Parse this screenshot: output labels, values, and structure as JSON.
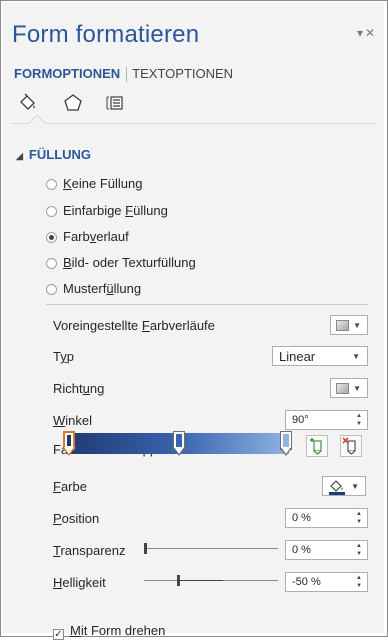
{
  "header": {
    "title": "Form formatieren",
    "dropdown_glyph": "▾",
    "close_glyph": "✕"
  },
  "tabs": {
    "active": "FORMOPTIONEN",
    "other": "TEXTOPTIONEN"
  },
  "icons": [
    "fill-line-icon",
    "effects-pentagon-icon",
    "size-properties-icon"
  ],
  "section": {
    "title": "FÜLLUNG",
    "toggle_glyph": "◢"
  },
  "fill_options": {
    "keine": {
      "pre": "",
      "key": "K",
      "post": "eine Füllung",
      "checked": false
    },
    "einfarbig": {
      "pre": "Einfarbige ",
      "key": "F",
      "post": "üllung",
      "checked": false
    },
    "farbverlauf": {
      "pre": "Farb",
      "key": "v",
      "post": "erlauf",
      "checked": true
    },
    "bild": {
      "pre": "",
      "key": "B",
      "post": "ild- oder Texturfüllung",
      "checked": false
    },
    "muster": {
      "pre": "Musterf",
      "key": "ü",
      "post": "llung",
      "checked": false
    }
  },
  "props": {
    "preset": {
      "pre": "Voreingestellte ",
      "key": "F",
      "post": "arbverläufe"
    },
    "typ": {
      "pre": "T",
      "key": "y",
      "post": "p",
      "value": "Linear"
    },
    "richtung": {
      "pre": "Richt",
      "key": "u",
      "post": "ng"
    },
    "winkel": {
      "pre": "",
      "key": "W",
      "post": "inkel",
      "value": "90°"
    },
    "stops_label": "Farbverlaufsstopps",
    "farbe": {
      "pre": "",
      "key": "F",
      "post": "arbe"
    },
    "position": {
      "pre": "",
      "key": "P",
      "post": "osition",
      "value": "0 %"
    },
    "transparenz": {
      "pre": "",
      "key": "T",
      "post": "ransparenz",
      "value": "0 %",
      "level": 0
    },
    "helligkeit": {
      "pre": "",
      "key": "H",
      "post": "elligkeit",
      "value": "-50 %",
      "level": -50
    }
  },
  "gradient": {
    "colors": [
      "#1f3a74",
      "#3a63ad",
      "#8fb3e3"
    ],
    "stops_count": 3,
    "selected_stop": 1
  },
  "checkbox": {
    "pre": "",
    "key": "M",
    "post": "it Form drehen",
    "checked": true,
    "check_glyph": "✓"
  },
  "colors": {
    "accent": "#2b579a",
    "selected_stop_border": "#d77a2a"
  }
}
